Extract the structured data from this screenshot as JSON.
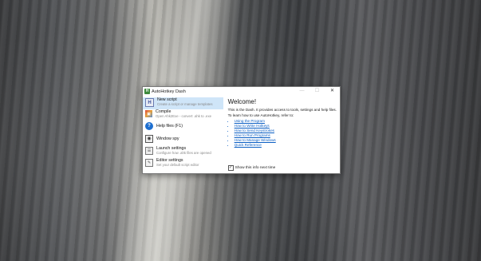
{
  "window": {
    "title": "AutoHotkey Dash",
    "minimize_glyph": "—",
    "maximize_glyph": "☐",
    "close_glyph": "✕"
  },
  "menu": {
    "items": [
      {
        "title": "New script",
        "subtitle": "Create a script or manage templates",
        "icon": "new-script-icon",
        "icon_glyph": "H"
      },
      {
        "title": "Compile",
        "subtitle": "Open Ahk2Exe - convert .ahk to .exe",
        "icon": "compile-icon",
        "icon_glyph": "▣"
      },
      {
        "title": "Help files (F1)",
        "subtitle": "",
        "icon": "help-icon",
        "icon_glyph": "?"
      },
      {
        "title": "Window spy",
        "subtitle": "",
        "icon": "window-spy-icon",
        "icon_glyph": "◉"
      },
      {
        "title": "Launch settings",
        "subtitle": "Configure how .ahk files are opened",
        "icon": "launch-settings-icon",
        "icon_glyph": "☰"
      },
      {
        "title": "Editor settings",
        "subtitle": "Set your default script editor",
        "icon": "editor-settings-icon",
        "icon_glyph": "✎"
      }
    ]
  },
  "welcome": {
    "heading": "Welcome!",
    "intro": "This is the Dash. It provides access to tools, settings and help files.",
    "learn": "To learn how to use AutoHotkey, refer to:",
    "links": [
      "Using the Program",
      "How to Write Hotkeys",
      "How to Send Keystrokes",
      "How to Run Programs",
      "How to Manage Windows",
      "Quick Reference"
    ],
    "show_next_label": "Show this info next time",
    "show_next_checked": true,
    "check_glyph": "✓"
  },
  "colors": {
    "selected_bg": "#cfe5f8",
    "link": "#0b5fc4",
    "help_icon": "#1e6fd0"
  }
}
